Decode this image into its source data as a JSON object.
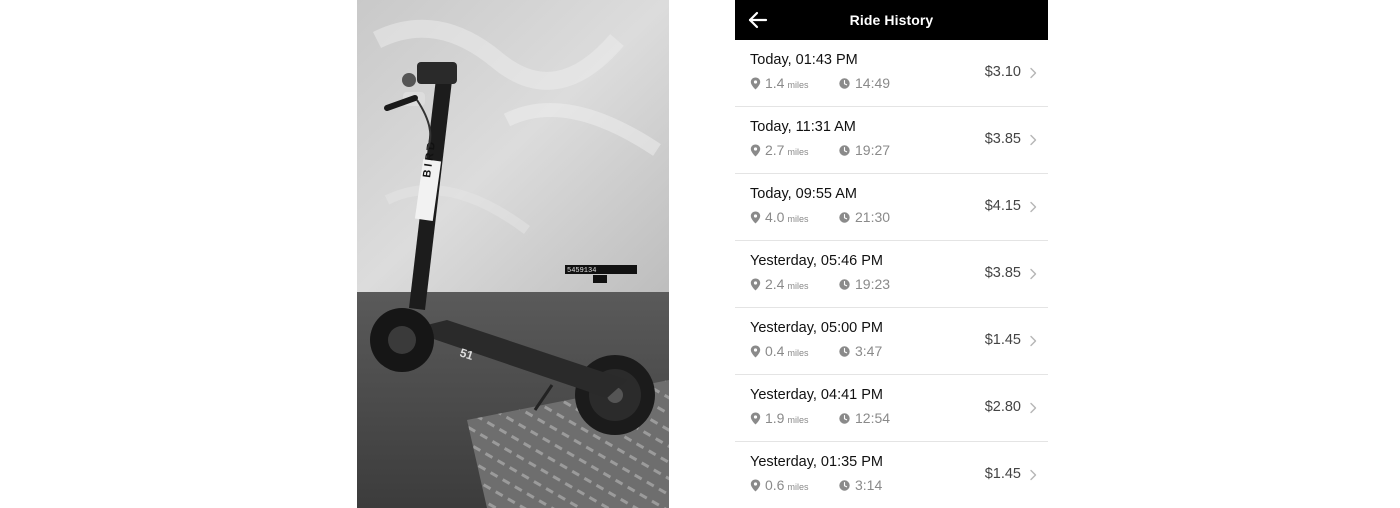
{
  "header": {
    "title": "Ride History",
    "back_icon": "arrow-left-icon"
  },
  "photo": {
    "description_icon": "scooter-photo",
    "stem_text": "BIRD",
    "plate_text": "5459134",
    "deck_text": "51"
  },
  "rides": [
    {
      "when": "Today, 01:43 PM",
      "distance": "1.4",
      "unit": "miles",
      "duration": "14:49",
      "price": "$3.10"
    },
    {
      "when": "Today, 11:31 AM",
      "distance": "2.7",
      "unit": "miles",
      "duration": "19:27",
      "price": "$3.85"
    },
    {
      "when": "Today, 09:55 AM",
      "distance": "4.0",
      "unit": "miles",
      "duration": "21:30",
      "price": "$4.15"
    },
    {
      "when": "Yesterday, 05:46 PM",
      "distance": "2.4",
      "unit": "miles",
      "duration": "19:23",
      "price": "$3.85"
    },
    {
      "when": "Yesterday, 05:00 PM",
      "distance": "0.4",
      "unit": "miles",
      "duration": "3:47",
      "price": "$1.45"
    },
    {
      "when": "Yesterday, 04:41 PM",
      "distance": "1.9",
      "unit": "miles",
      "duration": "12:54",
      "price": "$2.80"
    },
    {
      "when": "Yesterday, 01:35 PM",
      "distance": "0.6",
      "unit": "miles",
      "duration": "3:14",
      "price": "$1.45"
    }
  ]
}
